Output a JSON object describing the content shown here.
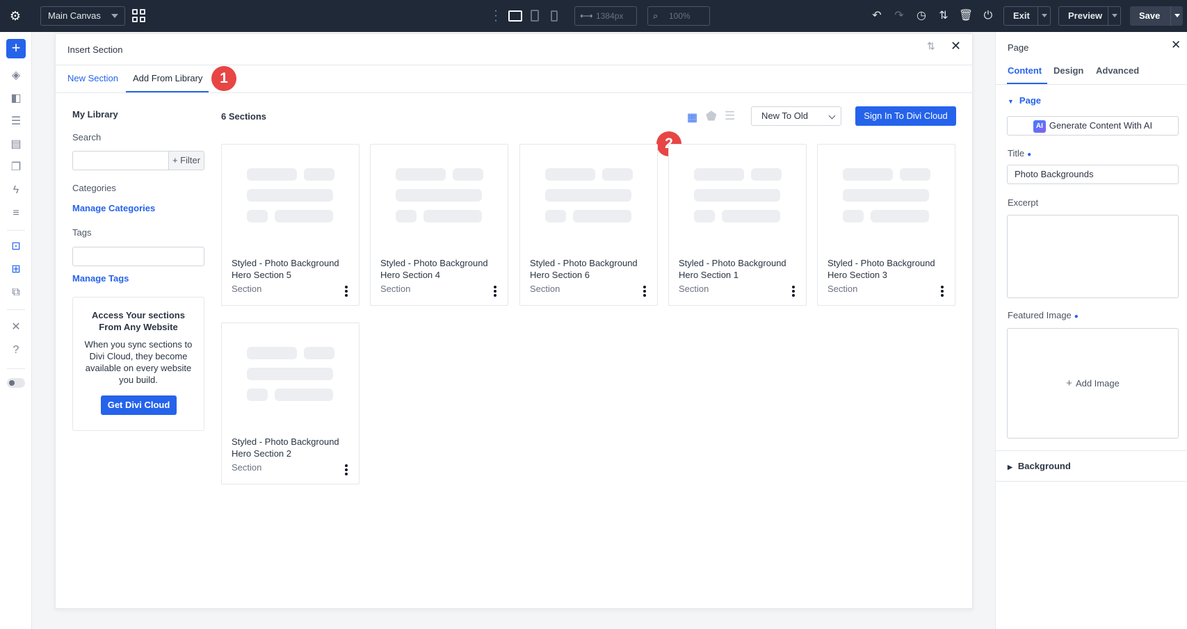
{
  "topbar": {
    "canvas_select": "Main Canvas",
    "width_value": "1384px",
    "zoom_value": "100%",
    "exit_label": "Exit",
    "preview_label": "Preview",
    "save_label": "Save"
  },
  "modal": {
    "title": "Insert Section",
    "tabs": [
      "New Section",
      "Add From Library"
    ],
    "sidebar": {
      "library_title": "My Library",
      "search_label": "Search",
      "filter_label": "+ Filter",
      "categories_label": "Categories",
      "manage_categories": "Manage Categories",
      "tags_label": "Tags",
      "manage_tags": "Manage Tags",
      "cloud_heading": "Access Your sections From Any Website",
      "cloud_text": "When you sync sections to Divi Cloud, they become available on every website you build.",
      "cloud_button": "Get Divi Cloud"
    },
    "count": "6 Sections",
    "sort_value": "New To Old",
    "sign_in_button": "Sign In To Divi Cloud",
    "cards": [
      {
        "name": "Styled - Photo Background Hero Section 5",
        "type": "Section"
      },
      {
        "name": "Styled - Photo Background Hero Section 4",
        "type": "Section"
      },
      {
        "name": "Styled - Photo Background Hero Section 6",
        "type": "Section"
      },
      {
        "name": "Styled - Photo Background Hero Section 1",
        "type": "Section"
      },
      {
        "name": "Styled - Photo Background Hero Section 3",
        "type": "Section"
      },
      {
        "name": "Styled - Photo Background Hero Section 2",
        "type": "Section"
      }
    ]
  },
  "badges": [
    "1",
    "2"
  ],
  "right_panel": {
    "title": "Page",
    "tabs": [
      "Content",
      "Design",
      "Advanced"
    ],
    "section_page": "Page",
    "ai_button": "Generate Content With AI",
    "ai_badge": "AI",
    "title_label": "Title",
    "title_value": "Photo Backgrounds",
    "excerpt_label": "Excerpt",
    "featured_label": "Featured Image",
    "add_image": "Add Image",
    "section_background": "Background"
  },
  "colors": {
    "accent": "#2563eb",
    "topbar": "#1f2937",
    "badge": "#e84545"
  },
  "icons": [
    "gear-icon",
    "grid-icon",
    "more-vertical-icon",
    "desktop-icon",
    "tablet-icon",
    "phone-icon",
    "width-icon",
    "zoom-icon",
    "undo-icon",
    "redo-icon",
    "history-icon",
    "sort-icon",
    "trash-icon",
    "power-icon",
    "plus-icon",
    "layers-icon",
    "close-icon",
    "kebab-icon"
  ]
}
